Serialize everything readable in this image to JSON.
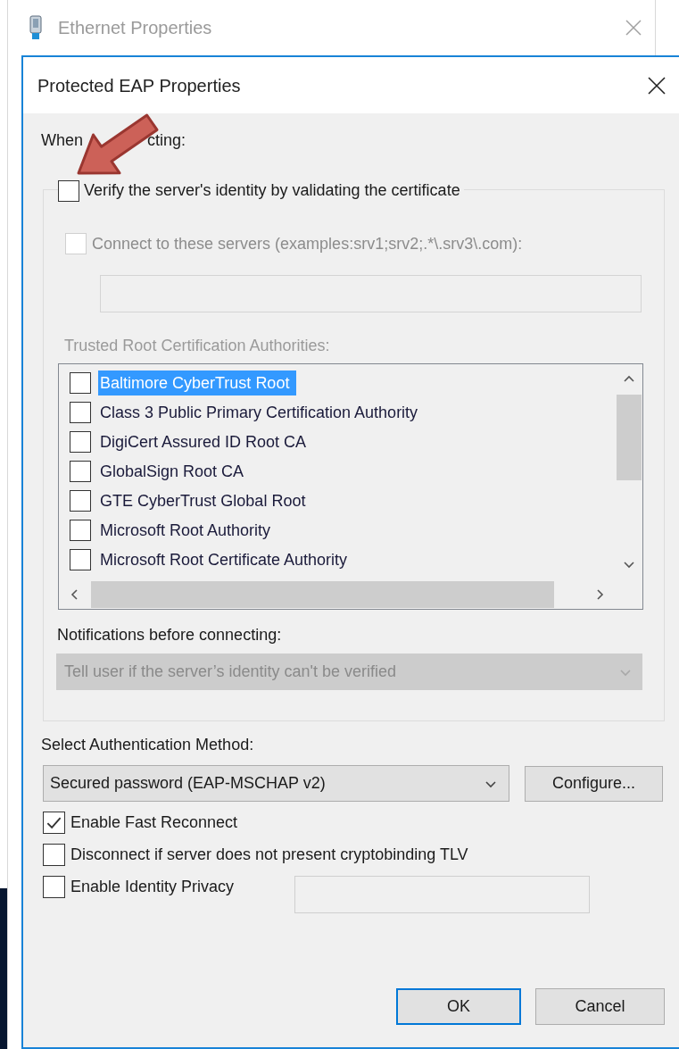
{
  "background_window": {
    "title": "Ethernet Properties"
  },
  "dialog": {
    "title": "Protected EAP Properties"
  },
  "connecting_label": {
    "start": "When",
    "end": "cting:"
  },
  "verify_certificate": {
    "label": "Verify the server's identity by validating the certificate",
    "checked": false
  },
  "connect_servers": {
    "label": "Connect to these servers (examples:srv1;srv2;.*\\.srv3\\.com):",
    "checked": false,
    "disabled": true
  },
  "trusted_roots": {
    "label": "Trusted Root Certification Authorities:",
    "disabled": true,
    "items": [
      {
        "label": "Baltimore CyberTrust Root",
        "checked": false,
        "selected": true
      },
      {
        "label": "Class 3 Public Primary Certification Authority",
        "checked": false,
        "selected": false
      },
      {
        "label": "DigiCert Assured ID Root CA",
        "checked": false,
        "selected": false
      },
      {
        "label": "GlobalSign Root CA",
        "checked": false,
        "selected": false
      },
      {
        "label": "GTE CyberTrust Global Root",
        "checked": false,
        "selected": false
      },
      {
        "label": "Microsoft Root Authority",
        "checked": false,
        "selected": false
      },
      {
        "label": "Microsoft Root Certificate Authority",
        "checked": false,
        "selected": false
      }
    ]
  },
  "notifications": {
    "label": "Notifications before connecting:",
    "value": "Tell user if the server’s identity can't be verified",
    "disabled": true
  },
  "auth_method": {
    "label": "Select Authentication Method:",
    "value": "Secured password (EAP-MSCHAP v2)"
  },
  "configure_button": "Configure...",
  "options": [
    {
      "kind": "plain",
      "label": "Enable Fast Reconnect",
      "checked": true
    },
    {
      "kind": "plain",
      "label": "Disconnect if server does not present cryptobinding TLV",
      "checked": false
    },
    {
      "kind": "with_field",
      "label": "Enable Identity Privacy",
      "checked": false
    }
  ],
  "buttons": [
    {
      "label": "OK",
      "default": true
    },
    {
      "label": "Cancel",
      "default": false
    }
  ]
}
